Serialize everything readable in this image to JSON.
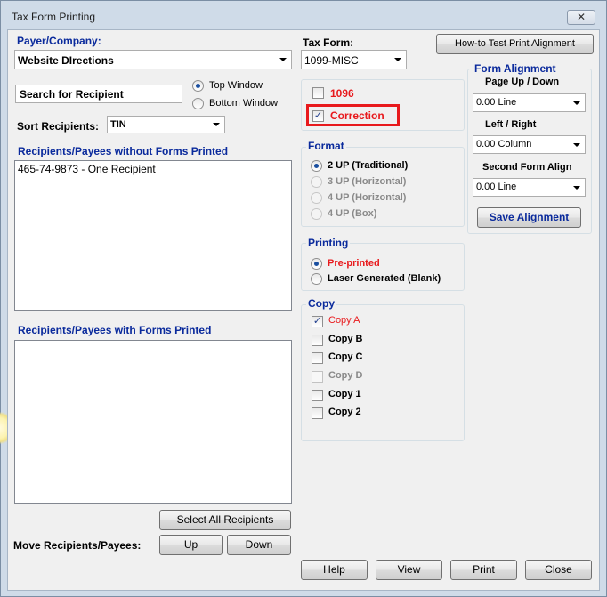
{
  "window": {
    "title": "Tax Form Printing",
    "close_glyph": "✕"
  },
  "payer": {
    "label": "Payer/Company:",
    "value": "Website DIrections"
  },
  "search": {
    "value": "Search for Recipient"
  },
  "window_position": {
    "options": [
      "Top Window",
      "Bottom Window"
    ],
    "selected": "Top Window"
  },
  "sort": {
    "label": "Sort Recipients:",
    "value": "TIN"
  },
  "without_forms": {
    "label": "Recipients/Payees without Forms Printed",
    "items": [
      "465-74-9873 - One Recipient"
    ]
  },
  "with_forms": {
    "label": "Recipients/Payees with Forms Printed",
    "items": []
  },
  "buttons": {
    "select_all": "Select All Recipients",
    "up": "Up",
    "down": "Down",
    "move_label": "Move Recipients/Payees:",
    "howto": "How-to Test Print  Alignment",
    "save_alignment": "Save  Alignment",
    "help": "Help",
    "view": "View",
    "print": "Print",
    "close": "Close"
  },
  "tax_form": {
    "label": "Tax Form:",
    "value": "1099-MISC"
  },
  "checks": {
    "f1096": {
      "label": "1096",
      "checked": false
    },
    "correction": {
      "label": "Correction",
      "checked": true
    }
  },
  "format": {
    "title": "Format",
    "options": [
      {
        "label": "2 UP (Traditional)",
        "selected": true,
        "enabled": true
      },
      {
        "label": "3 UP (Horizontal)",
        "selected": false,
        "enabled": false
      },
      {
        "label": "4 UP (Horizontal)",
        "selected": false,
        "enabled": false
      },
      {
        "label": "4 UP (Box)",
        "selected": false,
        "enabled": false
      }
    ]
  },
  "printing": {
    "title": "Printing",
    "options": [
      {
        "label": "Pre-printed",
        "selected": true
      },
      {
        "label": "Laser Generated (Blank)",
        "selected": false
      }
    ]
  },
  "copy": {
    "title": "Copy",
    "items": [
      {
        "label": "Copy A",
        "checked": true,
        "enabled": true
      },
      {
        "label": "Copy B",
        "checked": false,
        "enabled": true
      },
      {
        "label": "Copy C",
        "checked": false,
        "enabled": true
      },
      {
        "label": "Copy D",
        "checked": false,
        "enabled": false
      },
      {
        "label": "Copy 1",
        "checked": false,
        "enabled": true
      },
      {
        "label": "Copy 2",
        "checked": false,
        "enabled": true
      }
    ]
  },
  "alignment": {
    "title": "Form Alignment",
    "page_label": "Page Up / Down",
    "page_value": "0.00 Line",
    "lr_label": "Left / Right",
    "lr_value": "0.00 Column",
    "second_label": "Second Form Align",
    "second_value": "0.00 Line"
  },
  "colors": {
    "accent_blue": "#0a2a9c",
    "red": "#e8191c",
    "frame": "#cfdbe8",
    "client": "#f0f0f0"
  }
}
